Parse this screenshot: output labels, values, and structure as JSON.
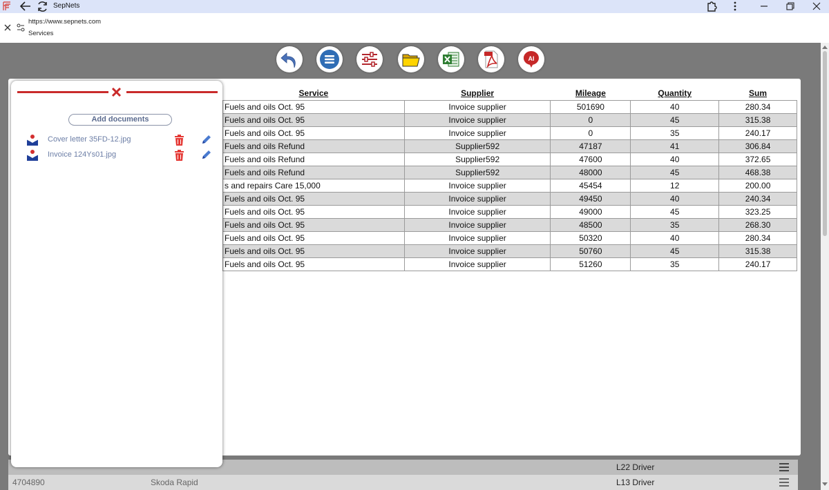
{
  "browser": {
    "tab_title": "SepNets",
    "url": "https://www.sepnets.com",
    "page_name": "Services"
  },
  "toolbar": {
    "items": [
      {
        "name": "back-arrow-icon"
      },
      {
        "name": "list-menu-icon"
      },
      {
        "name": "sliders-icon"
      },
      {
        "name": "folder-icon"
      },
      {
        "name": "excel-icon"
      },
      {
        "name": "pdf-icon"
      },
      {
        "name": "ai-icon",
        "label": "AI"
      }
    ]
  },
  "table": {
    "columns": [
      "Service",
      "Supplier",
      "Mileage",
      "Quantity",
      "Sum"
    ],
    "rows": [
      [
        "Fuels and oils Oct. 95",
        "Invoice supplier",
        "501690",
        "40",
        "280.34"
      ],
      [
        "Fuels and oils Oct. 95",
        "Invoice supplier",
        "0",
        "45",
        "315.38"
      ],
      [
        "Fuels and oils Oct. 95",
        "Invoice supplier",
        "0",
        "35",
        "240.17"
      ],
      [
        "Fuels and oils Refund",
        "Supplier592",
        "47187",
        "41",
        "306.84"
      ],
      [
        "Fuels and oils Refund",
        "Supplier592",
        "47600",
        "40",
        "372.65"
      ],
      [
        "Fuels and oils Refund",
        "Supplier592",
        "48000",
        "45",
        "468.38"
      ],
      [
        "s and repairs Care 15,000",
        "Invoice supplier",
        "45454",
        "12",
        "200.00"
      ],
      [
        "Fuels and oils Oct. 95",
        "Invoice supplier",
        "49450",
        "40",
        "240.34"
      ],
      [
        "Fuels and oils Oct. 95",
        "Invoice supplier",
        "49000",
        "45",
        "323.25"
      ],
      [
        "Fuels and oils Oct. 95",
        "Invoice supplier",
        "48500",
        "35",
        "268.30"
      ],
      [
        "Fuels and oils Oct. 95",
        "Invoice supplier",
        "50320",
        "40",
        "280.34"
      ],
      [
        "Fuels and oils Oct. 95",
        "Invoice supplier",
        "50760",
        "45",
        "315.38"
      ],
      [
        "Fuels and oils Oct. 95",
        "Invoice supplier",
        "51260",
        "35",
        "240.17"
      ]
    ]
  },
  "background_rows": [
    {
      "col1": "",
      "col2": "",
      "col3": "L22 Driver"
    },
    {
      "col1": "4704890",
      "col2": "Skoda Rapid",
      "col3": "L13 Driver"
    }
  ],
  "documents_popup": {
    "add_label": "Add documents",
    "files": [
      {
        "name": "Cover letter 35FD-12.jpg"
      },
      {
        "name": "Invoice 124Ys01.jpg"
      }
    ]
  },
  "colors": {
    "accent_red": "#c92a2a",
    "link_blue": "#6c7ea6",
    "overlay_gray": "#7a7a7a"
  }
}
